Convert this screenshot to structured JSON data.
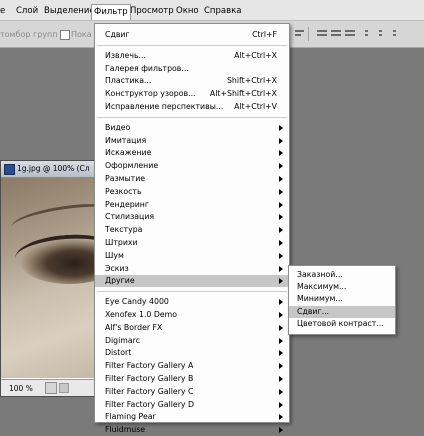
{
  "menubar": {
    "items": [
      "е",
      "Слой",
      "Выделение",
      "Фильтр",
      "Просмотр",
      "Окно",
      "Справка"
    ]
  },
  "options": {
    "group_text": "томбор групп",
    "show_text": "Пока"
  },
  "document": {
    "title": "1g.jpg @ 100% (Сл",
    "zoom": "100 %"
  },
  "filter_menu": {
    "groups": [
      [
        {
          "label": "Сдвиг",
          "shortcut": "Ctrl+F"
        }
      ],
      [
        {
          "label": "Извлечь...",
          "shortcut": "Alt+Ctrl+X"
        },
        {
          "label": "Галерея фильтров...",
          "shortcut": ""
        },
        {
          "label": "Пластика...",
          "shortcut": "Shift+Ctrl+X"
        },
        {
          "label": "Конструктор узоров...",
          "shortcut": "Alt+Shift+Ctrl+X"
        },
        {
          "label": "Исправление перспективы...",
          "shortcut": "Alt+Ctrl+V"
        }
      ],
      [
        {
          "label": "Видео",
          "submenu": true
        },
        {
          "label": "Имитация",
          "submenu": true
        },
        {
          "label": "Искажение",
          "submenu": true
        },
        {
          "label": "Оформление",
          "submenu": true
        },
        {
          "label": "Размытие",
          "submenu": true
        },
        {
          "label": "Резкость",
          "submenu": true
        },
        {
          "label": "Рендеринг",
          "submenu": true
        },
        {
          "label": "Стилизация",
          "submenu": true
        },
        {
          "label": "Текстура",
          "submenu": true
        },
        {
          "label": "Штрихи",
          "submenu": true
        },
        {
          "label": "Шум",
          "submenu": true
        },
        {
          "label": "Эскиз",
          "submenu": true
        },
        {
          "label": "Другие",
          "submenu": true,
          "highlighted": true
        }
      ],
      [
        {
          "label": "Eye Candy 4000",
          "submenu": true
        },
        {
          "label": "Xenofex 1.0 Demo",
          "submenu": true
        },
        {
          "label": "Alf's Border FX",
          "submenu": true
        },
        {
          "label": "Digimarc",
          "submenu": true
        },
        {
          "label": "Distort",
          "submenu": true
        },
        {
          "label": "Filter Factory Gallery A",
          "submenu": true
        },
        {
          "label": "Filter Factory Gallery B",
          "submenu": true
        },
        {
          "label": "Filter Factory Gallery C",
          "submenu": true
        },
        {
          "label": "Filter Factory Gallery D",
          "submenu": true
        },
        {
          "label": "Flaming Pear",
          "submenu": true
        },
        {
          "label": "Fluidmuse",
          "submenu": true
        }
      ]
    ]
  },
  "other_submenu": {
    "items": [
      {
        "label": "Заказной..."
      },
      {
        "label": "Максимум..."
      },
      {
        "label": "Минимум..."
      },
      {
        "label": "Сдвиг...",
        "highlighted": true
      },
      {
        "label": "Цветовой контраст..."
      }
    ]
  },
  "colors": {
    "highlight": "#c6c6c6",
    "menu_bg": "#fdfdfd",
    "workspace": "#7a7a7a"
  }
}
